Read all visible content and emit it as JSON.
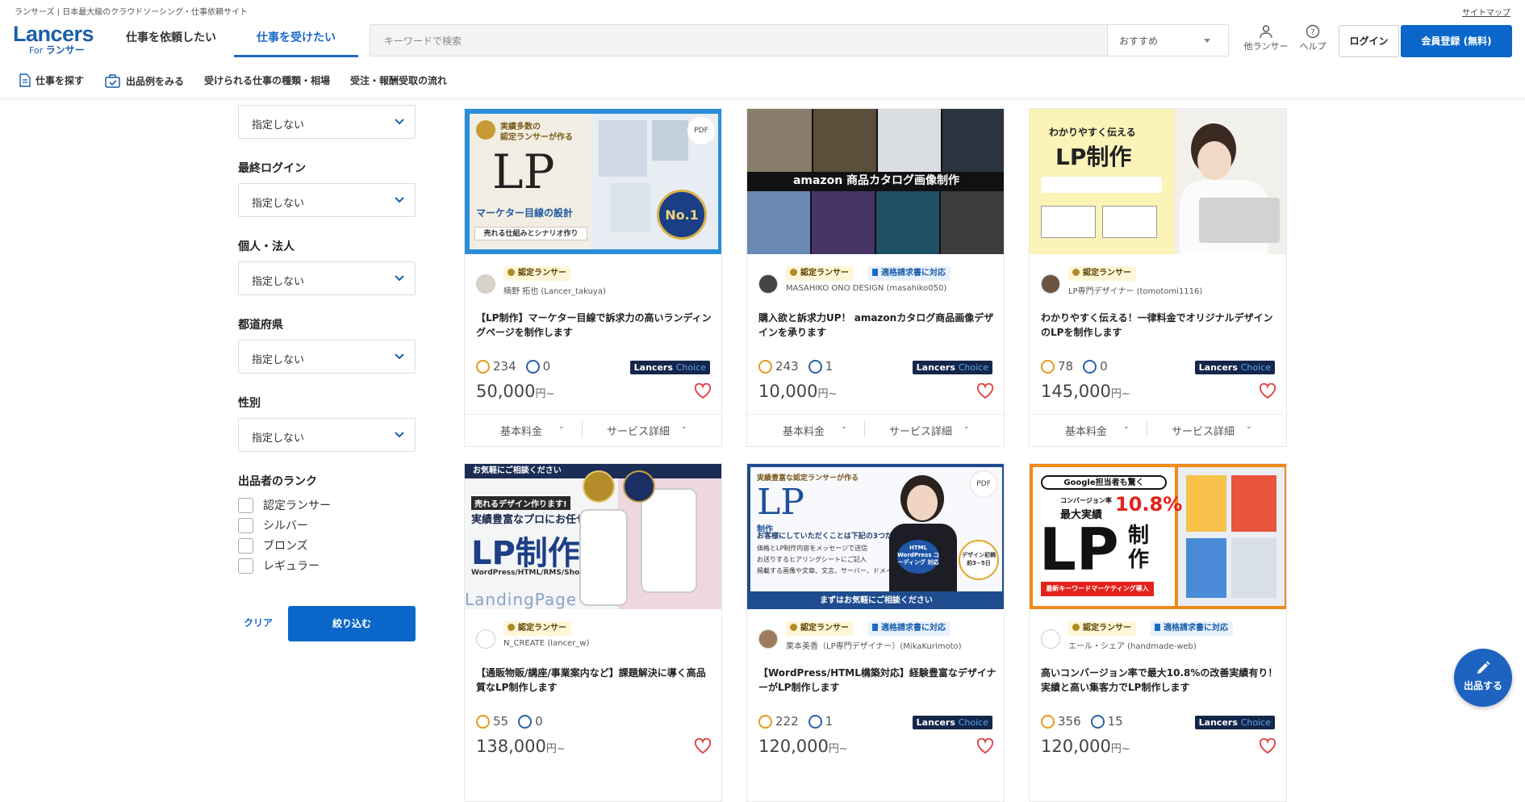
{
  "top": {
    "site_desc": "ランサーズ | 日本最大級のクラウドソーシング・仕事依頼サイト",
    "sitemap": "サイトマップ"
  },
  "header": {
    "logo_main": "Lancers",
    "logo_for": "For",
    "logo_sub": "ランサー",
    "tabs": [
      "仕事を依頼したい",
      "仕事を受けたい"
    ],
    "search_placeholder": "キーワードで検索",
    "sort_value": "おすすめ",
    "other_lancer": "他ランサー",
    "help": "ヘルプ",
    "login": "ログイン",
    "register": "会員登録 (無料)"
  },
  "subnav": [
    "仕事を探す",
    "出品例をみる",
    "受けられる仕事の種類・相場",
    "受注・報酬受取の流れ"
  ],
  "sidebar": {
    "unset": "指定しない",
    "labels": [
      "最終ログイン",
      "個人・法人",
      "都道府県",
      "性別",
      "出品者のランク"
    ],
    "ranks": [
      "認定ランサー",
      "シルバー",
      "ブロンズ",
      "レギュラー"
    ],
    "clear": "クリア",
    "apply": "絞り込む"
  },
  "badges": {
    "certified": "認定ランサー",
    "invoice": "適格請求書に対応",
    "choice_a": "Lancers",
    "choice_b": "Choice"
  },
  "footer_labels": {
    "basic": "基本料金",
    "detail": "サービス詳細"
  },
  "cards": [
    {
      "user": "楠野 拓也 (Lancer_takuya)",
      "title": "【LP制作】マーケター目線で訴求力の高いランディングページを制作します",
      "good": "234",
      "bad": "0",
      "price": "50,000",
      "yen": "円~",
      "img": {
        "t1": "実績多数の",
        "t2": "認定ランサーが作る",
        "big": "LP",
        "sub": "マーケター目線の設計",
        "ribbon": "売れる仕組みとシナリオ作り",
        "rank": "No.1",
        "pdf": "PDF"
      }
    },
    {
      "user": "MASAHIKO ONO DESIGN (masahiko050)",
      "title": "購入欲と訴求力UP！ amazonカタログ商品画像デザインを承ります",
      "good": "243",
      "bad": "1",
      "price": "10,000",
      "yen": "円~",
      "img": {
        "band": "amazon 商品カタログ画像制作"
      }
    },
    {
      "user": "LP専門デザイナー (tomotomi1116)",
      "title": "わかりやすく伝える！一律料金でオリジナルデザインのLPを制作します",
      "good": "78",
      "bad": "0",
      "price": "145,000",
      "yen": "円~",
      "img": {
        "t1": "わかりやすく伝える",
        "big": "LP制作"
      }
    },
    {
      "user": "N_CREATE (lancer_w)",
      "title": "【通販物販/講座/事業案内など】課題解決に導く高品質なLP制作します",
      "good": "55",
      "bad": "0",
      "price": "138,000",
      "yen": "円~",
      "img": {
        "top": "お気軽にご相談ください",
        "t1": "売れるデザイン作ります!",
        "t2": "実績豊富なプロにお任せ!",
        "big": "LP制作",
        "sub": "WordPress/HTML/RMS/Shopify etc",
        "foot": "LandingPage"
      }
    },
    {
      "user": "栗本美香（LP専門デザイナー）(MikaKurimoto)",
      "title": "【WordPress/HTML構築対応】経験豊富なデザイナーがLP制作します",
      "good": "222",
      "bad": "1",
      "price": "120,000",
      "yen": "円~",
      "img": {
        "t1": "実績豊富な認定ランサーが作る",
        "big": "LP",
        "big2": "制作",
        "mid": "お客様にしていただくことは下記の3つだけ",
        "l1": "価格とLP制作内容をメッセージで送信",
        "l2": "お送りするヒアリングシートにご記入",
        "l3": "掲載する画像や文章、文言、サーバー、ドメインのご用意",
        "foot": "まずはお気軽にご相談ください",
        "tag": "HTML WordPress コーディング 対応",
        "term": "デザイン初稿 約3~5日",
        "pdf": "PDF"
      }
    },
    {
      "user": "エール・シェア (handmade-web)",
      "title": "高いコンバージョン率で最大10.8%の改善実績有り！実績と高い集客力でLP制作します",
      "good": "356",
      "bad": "15",
      "price": "120,000",
      "yen": "円~",
      "img": {
        "t1": "Google担当者も驚く",
        "t2": "コンバージョン率",
        "t3": "最大実績",
        "pct": "10.8%",
        "big": "LP",
        "big2": "制作",
        "foot": "最新キーワードマーケティング導入"
      }
    }
  ],
  "fab": "出品する"
}
